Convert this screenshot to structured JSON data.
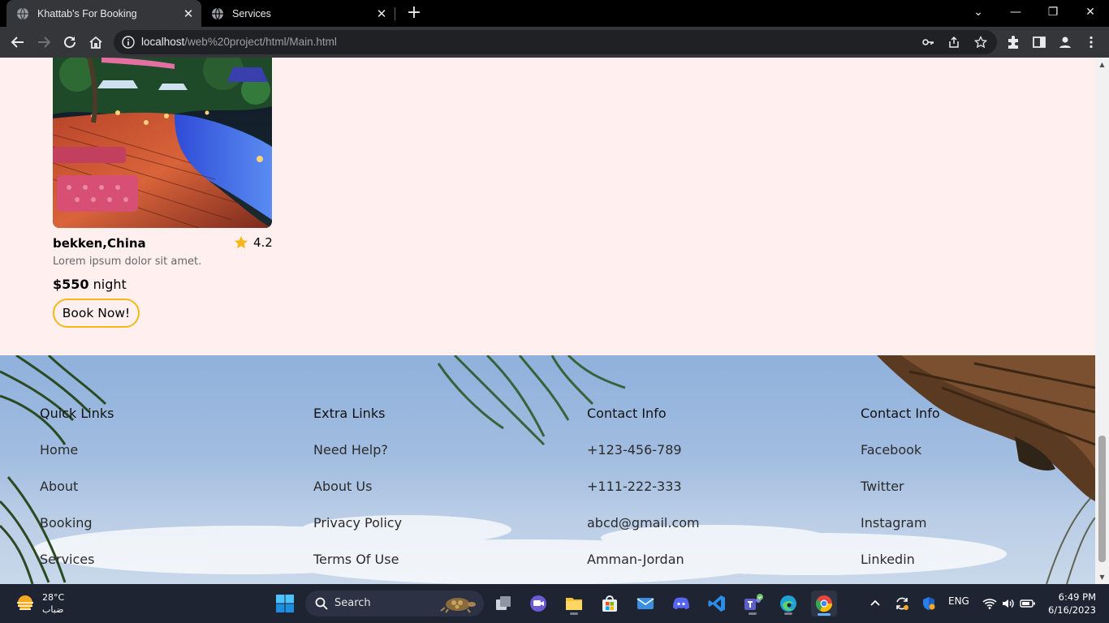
{
  "browser": {
    "tabs": [
      {
        "title": "Khattab's For Booking",
        "close": "✕"
      },
      {
        "title": "Services",
        "close": "✕"
      }
    ],
    "new_tab": "+",
    "window_controls": {
      "list": "⌄",
      "minimize": "—",
      "restore": "❐",
      "close": "✕"
    },
    "url_host": "localhost",
    "url_path": "/web%20project/html/Main.html"
  },
  "card": {
    "title": "bekken,China",
    "rating": "4.2",
    "description": "Lorem ipsum dolor sit amet.",
    "price": "$550",
    "price_unit": " night",
    "button": "Book Now!"
  },
  "footer": {
    "columns": [
      {
        "heading": "Quick Links",
        "links": [
          "Home",
          "About",
          "Booking",
          "Services"
        ]
      },
      {
        "heading": "Extra Links",
        "links": [
          "Need Help?",
          "About Us",
          "Privacy Policy",
          "Terms Of Use"
        ]
      },
      {
        "heading": "Contact Info",
        "links": [
          "+123-456-789",
          "+111-222-333",
          "abcd@gmail.com",
          "Amman-Jordan"
        ]
      },
      {
        "heading": "Contact Info",
        "links": [
          "Facebook",
          "Twitter",
          "Instagram",
          "Linkedin"
        ]
      }
    ]
  },
  "taskbar": {
    "weather_temp": "28°C",
    "weather_desc": "ضباب",
    "search_label": "Search",
    "language": "ENG",
    "time": "6:49 PM",
    "date": "6/16/2023"
  },
  "colors": {
    "page_bg": "#fff0ef",
    "button_border": "#f6b818",
    "star": "#f6b818"
  }
}
